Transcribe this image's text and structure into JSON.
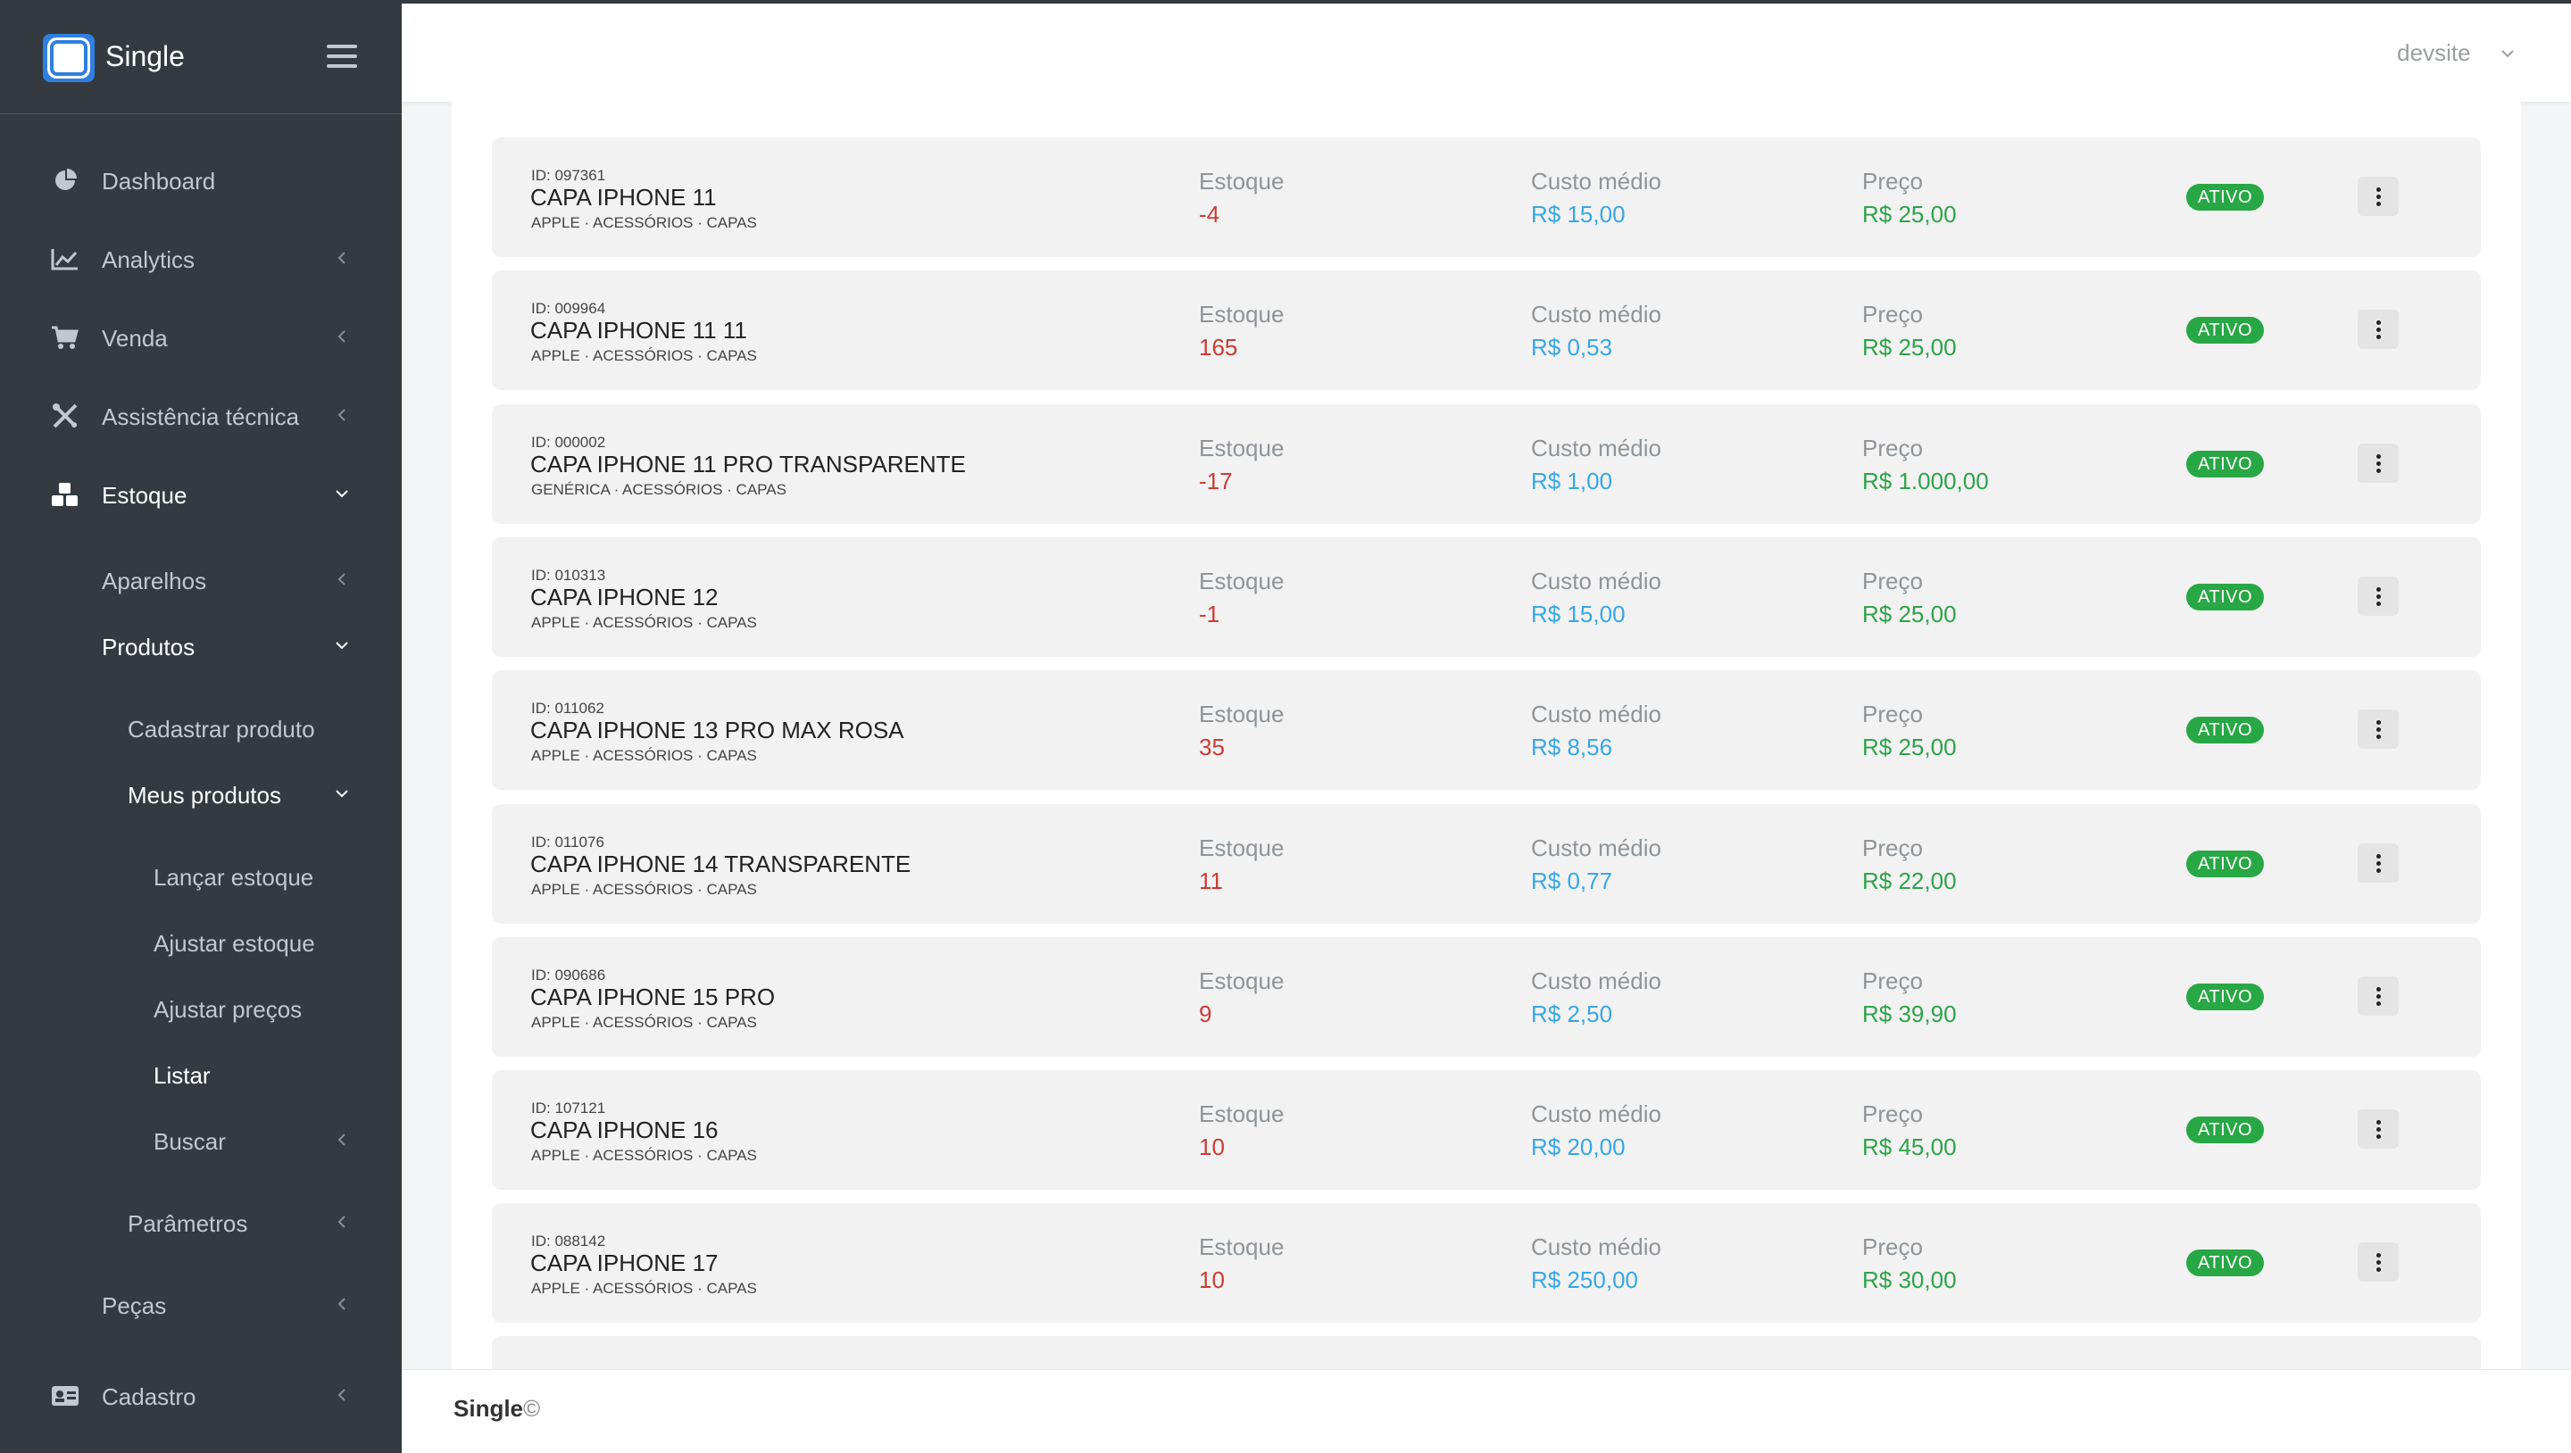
{
  "app": {
    "name": "Single",
    "footer_brand": "Single",
    "footer_copy": "©"
  },
  "user": {
    "name": "devsite"
  },
  "colors": {
    "sidebar_bg": "#343a40",
    "estoque": "#cc3b34",
    "custo": "#37a7e6",
    "preco": "#2fa34a",
    "badge": "#28a745"
  },
  "sidebar": {
    "dashboard": "Dashboard",
    "analytics": "Analytics",
    "venda": "Venda",
    "assistencia": "Assistência técnica",
    "estoque": "Estoque",
    "aparelhos": "Aparelhos",
    "produtos": "Produtos",
    "cadastrar_produto": "Cadastrar produto",
    "meus_produtos": "Meus produtos",
    "lancar_estoque": "Lançar estoque",
    "ajustar_estoque": "Ajustar estoque",
    "ajustar_precos": "Ajustar preços",
    "listar": "Listar",
    "buscar": "Buscar",
    "parametros": "Parâmetros",
    "pecas": "Peças",
    "cadastro": "Cadastro"
  },
  "labels": {
    "estoque": "Estoque",
    "custo": "Custo médio",
    "preco": "Preço"
  },
  "products": [
    {
      "id": "ID: 097361",
      "name": "CAPA IPHONE 11",
      "category": "APPLE · ACESSÓRIOS · CAPAS",
      "estoque": "-4",
      "custo": "R$ 15,00",
      "preco": "R$ 25,00",
      "status": "ATIVO"
    },
    {
      "id": "ID: 009964",
      "name": "CAPA IPHONE 11 11",
      "category": "APPLE · ACESSÓRIOS · CAPAS",
      "estoque": "165",
      "custo": "R$ 0,53",
      "preco": "R$ 25,00",
      "status": "ATIVO"
    },
    {
      "id": "ID: 000002",
      "name": "CAPA IPHONE 11 PRO TRANSPARENTE",
      "category": "GENÉRICA · ACESSÓRIOS · CAPAS",
      "estoque": "-17",
      "custo": "R$ 1,00",
      "preco": "R$ 1.000,00",
      "status": "ATIVO"
    },
    {
      "id": "ID: 010313",
      "name": "CAPA IPHONE 12",
      "category": "APPLE · ACESSÓRIOS · CAPAS",
      "estoque": "-1",
      "custo": "R$ 15,00",
      "preco": "R$ 25,00",
      "status": "ATIVO"
    },
    {
      "id": "ID: 011062",
      "name": "CAPA IPHONE 13 PRO MAX ROSA",
      "category": "APPLE · ACESSÓRIOS · CAPAS",
      "estoque": "35",
      "custo": "R$ 8,56",
      "preco": "R$ 25,00",
      "status": "ATIVO"
    },
    {
      "id": "ID: 011076",
      "name": "CAPA IPHONE 14 TRANSPARENTE",
      "category": "APPLE · ACESSÓRIOS · CAPAS",
      "estoque": "11",
      "custo": "R$ 0,77",
      "preco": "R$ 22,00",
      "status": "ATIVO"
    },
    {
      "id": "ID: 090686",
      "name": "CAPA IPHONE 15 PRO",
      "category": "APPLE · ACESSÓRIOS · CAPAS",
      "estoque": "9",
      "custo": "R$ 2,50",
      "preco": "R$ 39,90",
      "status": "ATIVO"
    },
    {
      "id": "ID: 107121",
      "name": "CAPA IPHONE 16",
      "category": "APPLE · ACESSÓRIOS · CAPAS",
      "estoque": "10",
      "custo": "R$ 20,00",
      "preco": "R$ 45,00",
      "status": "ATIVO"
    },
    {
      "id": "ID: 088142",
      "name": "CAPA IPHONE 17",
      "category": "APPLE · ACESSÓRIOS · CAPAS",
      "estoque": "10",
      "custo": "R$ 250,00",
      "preco": "R$ 30,00",
      "status": "ATIVO"
    }
  ]
}
